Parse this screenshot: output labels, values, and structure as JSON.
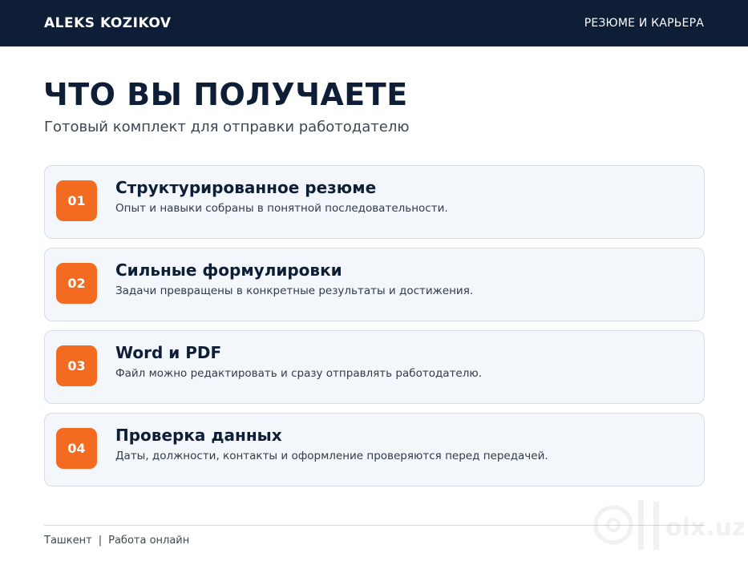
{
  "header": {
    "brand": "ALEKS KOZIKOV",
    "nav_link": "РЕЗЮМЕ И КАРЬЕРА"
  },
  "main": {
    "title": "ЧТО ВЫ ПОЛУЧАЕТЕ",
    "subtitle": "Готовый комплект для отправки работодателю",
    "items": [
      {
        "number": "01",
        "title": "Структурированное резюме",
        "description": "Опыт и навыки собраны в понятной последовательности."
      },
      {
        "number": "02",
        "title": "Сильные формулировки",
        "description": "Задачи превращены в конкретные результаты и достижения."
      },
      {
        "number": "03",
        "title": "Word и PDF",
        "description": "Файл можно редактировать и сразу отправлять работодателю."
      },
      {
        "number": "04",
        "title": "Проверка данных",
        "description": "Даты, должности, контакты и оформление проверяются перед передачей."
      }
    ]
  },
  "footer": {
    "city": "Ташкент",
    "separator": "|",
    "mode": "Работа онлайн"
  },
  "watermark": {
    "text": "olx.uz"
  },
  "colors": {
    "header_bg": "#0e1e36",
    "accent": "#f26b21",
    "card_bg": "#f3f6fa",
    "card_border": "#d6dde6"
  }
}
